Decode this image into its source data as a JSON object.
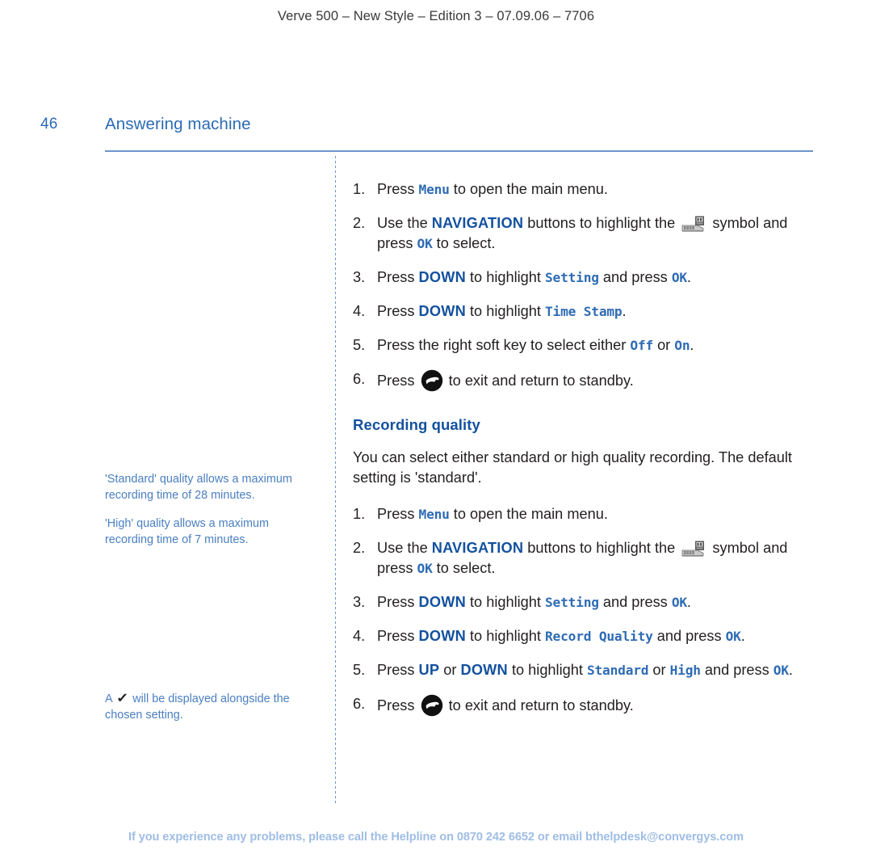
{
  "running_head": "Verve 500 – New Style – Edition 3 – 07.09.06 – 7706",
  "page": {
    "folio": "46",
    "chapter_title": "Answering machine"
  },
  "colors": {
    "heading_blue": "#2b6bb5",
    "key_blue": "#14519e",
    "lcd_blue": "#2f6cb4",
    "sidenote_blue": "#4a7fc1",
    "rule_blue": "#6b93c9",
    "footer_blue": "#9fbde4",
    "body_text": "#231f20"
  },
  "sidenotes": [
    "'Standard' quality allows a maximum recording time of 28 minutes.",
    "'High' quality allows a maximum recording time of 7 minutes."
  ],
  "sidenote_tick": {
    "before": "A ",
    "icon": "check-icon",
    "glyph": "✓",
    "after": " will be displayed alongside the chosen setting."
  },
  "icons": {
    "answering_machine": "answering-machine-icon",
    "end_call": "end-call-icon"
  },
  "time_stamp_steps": [
    {
      "num": "1.",
      "parts": [
        {
          "t": "Press ",
          "s": "plain"
        },
        {
          "t": "Menu",
          "s": "lcd"
        },
        {
          "t": " to open the main menu.",
          "s": "plain"
        }
      ]
    },
    {
      "num": "2.",
      "parts": [
        {
          "t": "Use the ",
          "s": "plain"
        },
        {
          "t": "NAVIGATION",
          "s": "key"
        },
        {
          "t": " buttons to highlight the ",
          "s": "plain"
        },
        {
          "t": "",
          "s": "icon-am"
        },
        {
          "t": " symbol and press ",
          "s": "plain"
        },
        {
          "t": "OK",
          "s": "lcd"
        },
        {
          "t": " to select.",
          "s": "plain"
        }
      ]
    },
    {
      "num": "3.",
      "parts": [
        {
          "t": "Press ",
          "s": "plain"
        },
        {
          "t": "DOWN",
          "s": "key"
        },
        {
          "t": " to highlight ",
          "s": "plain"
        },
        {
          "t": "Setting",
          "s": "lcd"
        },
        {
          "t": " and press ",
          "s": "plain"
        },
        {
          "t": "OK",
          "s": "lcd"
        },
        {
          "t": ".",
          "s": "plain"
        }
      ]
    },
    {
      "num": "4.",
      "parts": [
        {
          "t": "Press ",
          "s": "plain"
        },
        {
          "t": "DOWN",
          "s": "key"
        },
        {
          "t": " to highlight ",
          "s": "plain"
        },
        {
          "t": "Time Stamp",
          "s": "lcd"
        },
        {
          "t": ".",
          "s": "plain"
        }
      ]
    },
    {
      "num": "5.",
      "parts": [
        {
          "t": "Press the right soft key to select either ",
          "s": "plain"
        },
        {
          "t": "Off",
          "s": "lcd"
        },
        {
          "t": " or ",
          "s": "plain"
        },
        {
          "t": "On",
          "s": "lcd"
        },
        {
          "t": ".",
          "s": "plain"
        }
      ]
    },
    {
      "num": "6.",
      "parts": [
        {
          "t": "Press ",
          "s": "plain"
        },
        {
          "t": "",
          "s": "icon-end"
        },
        {
          "t": " to exit and return to standby.",
          "s": "plain"
        }
      ]
    }
  ],
  "recording_quality": {
    "heading": "Recording quality",
    "intro": "You can select either standard or high quality recording. The default setting is 'standard'.",
    "steps": [
      {
        "num": "1.",
        "parts": [
          {
            "t": "Press ",
            "s": "plain"
          },
          {
            "t": "Menu",
            "s": "lcd"
          },
          {
            "t": " to open the main menu.",
            "s": "plain"
          }
        ]
      },
      {
        "num": "2.",
        "parts": [
          {
            "t": "Use the ",
            "s": "plain"
          },
          {
            "t": "NAVIGATION",
            "s": "key"
          },
          {
            "t": " buttons to highlight the ",
            "s": "plain"
          },
          {
            "t": "",
            "s": "icon-am"
          },
          {
            "t": " symbol and press ",
            "s": "plain"
          },
          {
            "t": "OK",
            "s": "lcd"
          },
          {
            "t": " to select.",
            "s": "plain"
          }
        ]
      },
      {
        "num": "3.",
        "parts": [
          {
            "t": "Press ",
            "s": "plain"
          },
          {
            "t": "DOWN",
            "s": "key"
          },
          {
            "t": " to highlight ",
            "s": "plain"
          },
          {
            "t": "Setting",
            "s": "lcd"
          },
          {
            "t": " and press ",
            "s": "plain"
          },
          {
            "t": "OK",
            "s": "lcd"
          },
          {
            "t": ".",
            "s": "plain"
          }
        ]
      },
      {
        "num": "4.",
        "parts": [
          {
            "t": "Press ",
            "s": "plain"
          },
          {
            "t": "DOWN",
            "s": "key"
          },
          {
            "t": " to highlight ",
            "s": "plain"
          },
          {
            "t": "Record Quality",
            "s": "lcd"
          },
          {
            "t": " and press ",
            "s": "plain"
          },
          {
            "t": "OK",
            "s": "lcd"
          },
          {
            "t": ".",
            "s": "plain"
          }
        ]
      },
      {
        "num": "5.",
        "parts": [
          {
            "t": "Press ",
            "s": "plain"
          },
          {
            "t": "UP",
            "s": "key"
          },
          {
            "t": " or ",
            "s": "plain"
          },
          {
            "t": "DOWN",
            "s": "key"
          },
          {
            "t": " to highlight ",
            "s": "plain"
          },
          {
            "t": "Standard",
            "s": "lcd"
          },
          {
            "t": " or ",
            "s": "plain"
          },
          {
            "t": "High",
            "s": "lcd"
          },
          {
            "t": " and press ",
            "s": "plain"
          },
          {
            "t": "OK",
            "s": "lcd"
          },
          {
            "t": ".",
            "s": "plain"
          }
        ]
      },
      {
        "num": "6.",
        "parts": [
          {
            "t": "Press ",
            "s": "plain"
          },
          {
            "t": "",
            "s": "icon-end"
          },
          {
            "t": " to exit and return to standby.",
            "s": "plain"
          }
        ]
      }
    ]
  },
  "footer": "If you experience any problems, please call the Helpline on 0870 242 6652 or email bthelpdesk@convergys.com"
}
